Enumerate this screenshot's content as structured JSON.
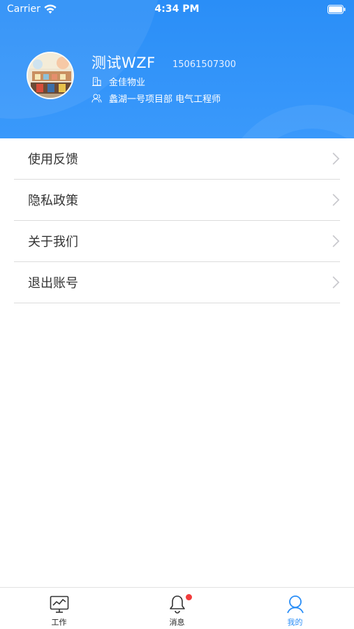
{
  "status_bar": {
    "carrier": "Carrier",
    "time": "4:34 PM"
  },
  "profile": {
    "name": "测试WZF",
    "phone": "15061507300",
    "company": "金佳物业",
    "role": "蠡湖一号项目部 电气工程师",
    "avatar_icon": "avatar-photo"
  },
  "menu": {
    "items": [
      {
        "label": "使用反馈",
        "icon": "chevron-right-icon"
      },
      {
        "label": "隐私政策",
        "icon": "chevron-right-icon"
      },
      {
        "label": "关于我们",
        "icon": "chevron-right-icon"
      },
      {
        "label": "退出账号",
        "icon": "chevron-right-icon"
      }
    ]
  },
  "tabbar": {
    "tabs": [
      {
        "label": "工作",
        "icon": "monitor-chart-icon",
        "active": false
      },
      {
        "label": "消息",
        "icon": "bell-icon",
        "active": false,
        "badge": true
      },
      {
        "label": "我的",
        "icon": "user-icon",
        "active": true
      }
    ]
  },
  "colors": {
    "header_blue": "#2a8ef7",
    "active_tab": "#2a8ef7",
    "badge_red": "#f23c3c"
  }
}
